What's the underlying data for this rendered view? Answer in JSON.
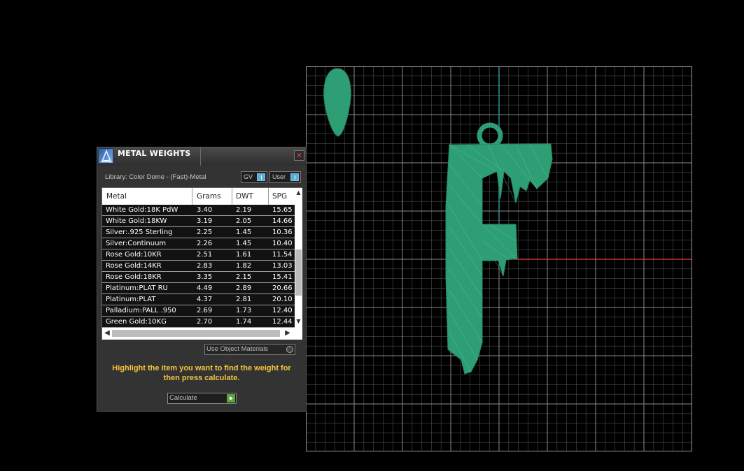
{
  "panel": {
    "title": "METAL WEIGHTS",
    "close_glyph": "✕",
    "library_label": "Library: Color Dome - (Fast)-Metal",
    "toggle_gv": "GV",
    "toggle_user": "User",
    "table": {
      "columns": [
        "Metal",
        "Grams",
        "DWT",
        "SPG"
      ],
      "rows": [
        [
          "White Gold:18K PdW",
          "3.40",
          "2.19",
          "15.65"
        ],
        [
          "White Gold:18KW",
          "3.19",
          "2.05",
          "14.66"
        ],
        [
          "Silver:.925 Sterling",
          "2.25",
          "1.45",
          "10.36"
        ],
        [
          "Silver:Continuum",
          "2.26",
          "1.45",
          "10.40"
        ],
        [
          "Rose Gold:10KR",
          "2.51",
          "1.61",
          "11.54"
        ],
        [
          "Rose Gold:14KR",
          "2.83",
          "1.82",
          "13.03"
        ],
        [
          "Rose Gold:18KR",
          "3.35",
          "2.15",
          "15.41"
        ],
        [
          "Platinum:PLAT RU",
          "4.49",
          "2.89",
          "20.66"
        ],
        [
          "Platinum:PLAT",
          "4.37",
          "2.81",
          "20.10"
        ],
        [
          "Palladium:PALL .950",
          "2.69",
          "1.73",
          "12.40"
        ],
        [
          "Green Gold:10KG",
          "2.70",
          "1.74",
          "12.44"
        ]
      ]
    },
    "use_object_materials_label": "Use Object Materials",
    "hint": "Highlight the item you want to find the weight for then press calculate.",
    "calculate_label": "Calculate"
  },
  "colors": {
    "model": "#2e9e74",
    "grid": "#7a7a7a",
    "axis_x": "#c0392b",
    "axis_y": "#2a8f9a",
    "hint_text": "#f2c53d"
  },
  "icons": {
    "logo": "app-logo-icon",
    "close": "close-icon",
    "scroll_up": "chevron-up-icon",
    "scroll_down": "chevron-down-icon",
    "scroll_left": "chevron-left-icon",
    "scroll_right": "chevron-right-icon",
    "calculate": "play-icon"
  }
}
